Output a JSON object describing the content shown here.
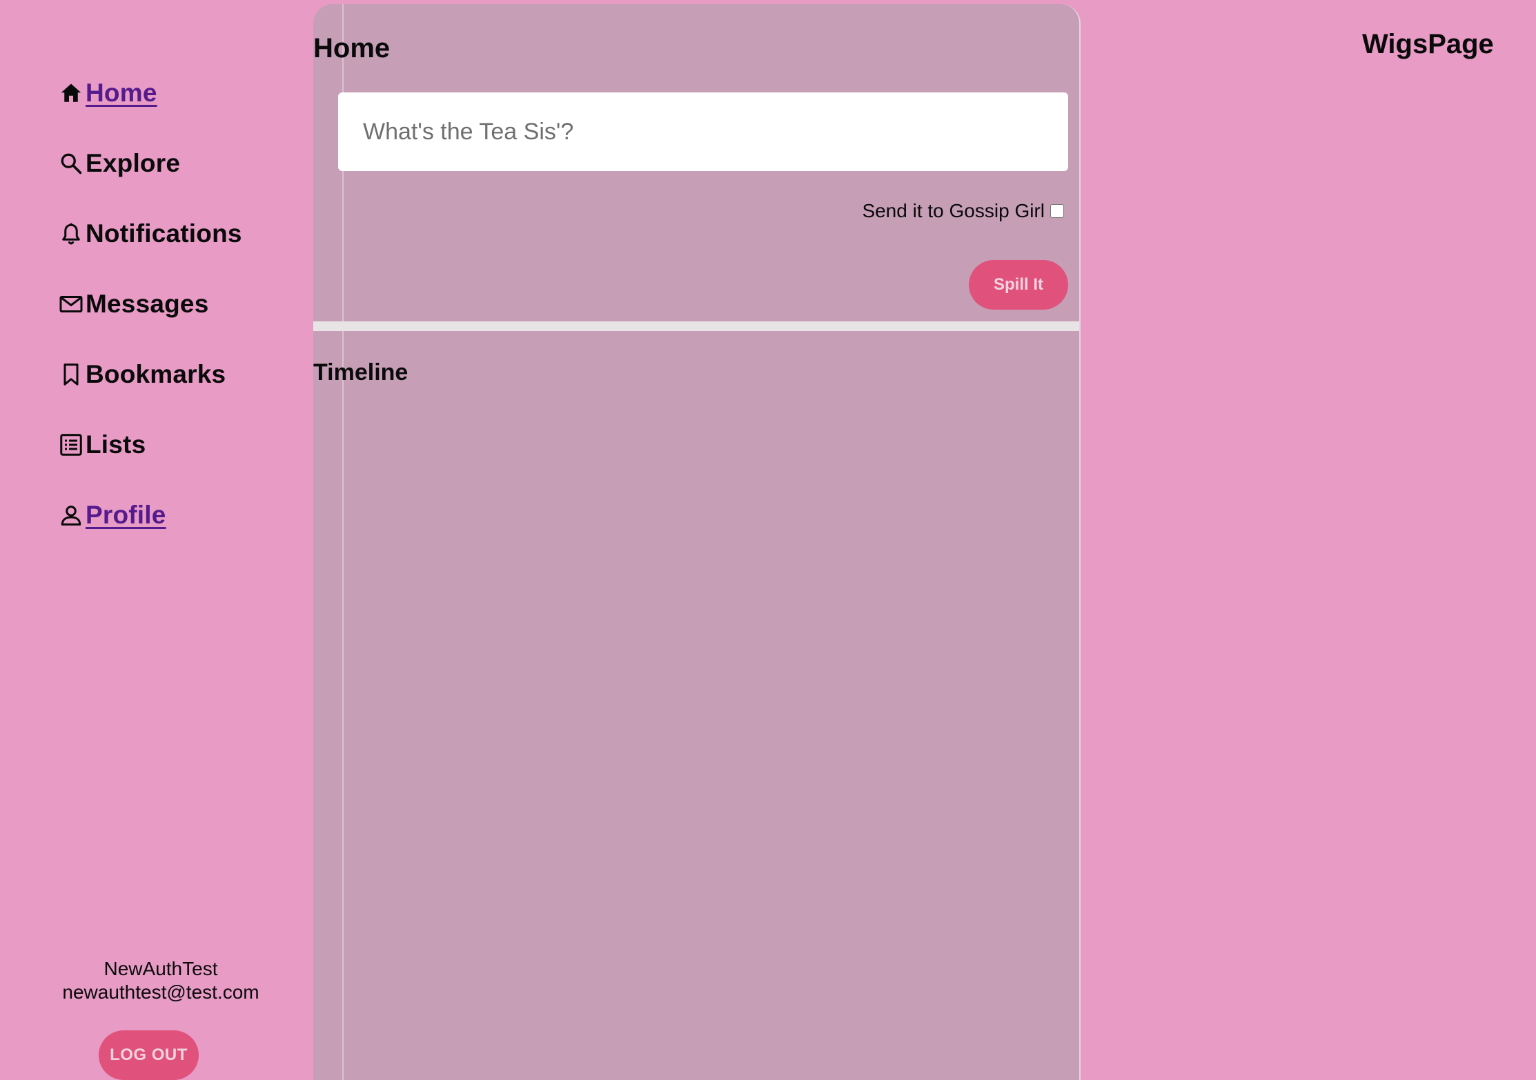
{
  "brand": {
    "name": "WigsPage"
  },
  "sidebar": {
    "items": [
      {
        "label": "Home",
        "icon": "home-icon",
        "link": true
      },
      {
        "label": "Explore",
        "icon": "search-icon",
        "link": false
      },
      {
        "label": "Notifications",
        "icon": "bell-icon",
        "link": false
      },
      {
        "label": "Messages",
        "icon": "mail-icon",
        "link": false
      },
      {
        "label": "Bookmarks",
        "icon": "bookmark-icon",
        "link": false
      },
      {
        "label": "Lists",
        "icon": "list-icon",
        "link": false
      },
      {
        "label": "Profile",
        "icon": "user-icon",
        "link": true
      }
    ],
    "user": {
      "name": "NewAuthTest",
      "email": "newauthtest@test.com"
    },
    "logout_label": "LOG OUT"
  },
  "main": {
    "title": "Home",
    "compose": {
      "placeholder": "What's the Tea Sis'?",
      "value": "",
      "gossip_label": "Send it to Gossip Girl",
      "gossip_checked": false,
      "submit_label": "Spill It"
    },
    "timeline_title": "Timeline"
  },
  "colors": {
    "background": "#e79bc5",
    "panel": "#c69fb7",
    "accent": "#e0527b",
    "link": "#551a8b"
  }
}
